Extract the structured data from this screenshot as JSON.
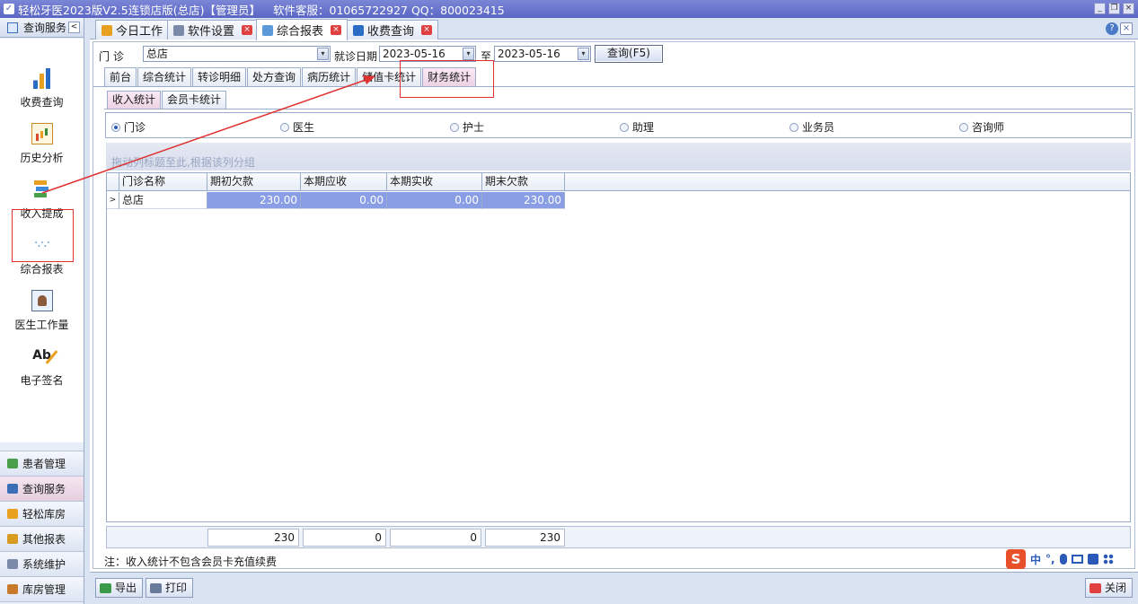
{
  "window": {
    "title": "轻松牙医2023版V2.5连锁店版(总店)【管理员】",
    "service": "软件客服：01065722927 QQ：800023415",
    "btn_min": "_",
    "btn_restore": "❐",
    "btn_close": "×"
  },
  "sidebar": {
    "header": "查询服务",
    "collapse": "<",
    "items": [
      {
        "label": "收费查询",
        "icon": "bar-chart-icon"
      },
      {
        "label": "历史分析",
        "icon": "history-chart-icon"
      },
      {
        "label": "收入提成",
        "icon": "stack-icon"
      },
      {
        "label": "综合报表",
        "icon": "dots-icon"
      },
      {
        "label": "医生工作量",
        "icon": "doctor-icon"
      },
      {
        "label": "电子签名",
        "icon": "signature-icon"
      }
    ],
    "nav": [
      {
        "label": "患者管理",
        "color": "#4aa04a"
      },
      {
        "label": "查询服务",
        "color": "#3a6fb8"
      },
      {
        "label": "轻松库房",
        "color": "#e8a020"
      },
      {
        "label": "其他报表",
        "color": "#d89a20"
      },
      {
        "label": "系统维护",
        "color": "#7a8aa8"
      },
      {
        "label": "库房管理",
        "color": "#c87a2a"
      }
    ],
    "expand": ">"
  },
  "doc_tabs": [
    {
      "label": "今日工作",
      "icon_color": "#e8a020"
    },
    {
      "label": "软件设置",
      "icon_color": "#7a8aa8"
    },
    {
      "label": "综合报表",
      "icon_color": "#5a9ad8"
    },
    {
      "label": "收费查询",
      "icon_color": "#2b6cc4"
    }
  ],
  "tab_close": "×",
  "help": "?",
  "help_close": "×",
  "filter": {
    "clinic_label": "门  诊",
    "clinic_value": "总店",
    "date_label": "就诊日期",
    "date_from": "2023-05-16",
    "to_label": "至",
    "date_to": "2023-05-16",
    "query_button": "查询(F5)",
    "arrow": "▾"
  },
  "report_tabs": [
    "前台",
    "综合统计",
    "转诊明细",
    "处方查询",
    "病历统计",
    "储值卡统计",
    "财务统计"
  ],
  "sub_tabs": [
    "收入统计",
    "会员卡统计"
  ],
  "radios": [
    {
      "label": "门诊",
      "checked": true
    },
    {
      "label": "医生",
      "checked": false
    },
    {
      "label": "护士",
      "checked": false
    },
    {
      "label": "助理",
      "checked": false
    },
    {
      "label": "业务员",
      "checked": false
    },
    {
      "label": "咨询师",
      "checked": false
    }
  ],
  "group_hint": "拖动列标题至此,根据该列分组",
  "grid": {
    "columns": [
      "门诊名称",
      "期初欠款",
      "本期应收",
      "本期实收",
      "期末欠款"
    ],
    "rows": [
      {
        "indicator": ">",
        "cells": [
          "总店",
          "230.00",
          "0.00",
          "0.00",
          "230.00"
        ]
      }
    ],
    "totals": [
      "230",
      "0",
      "0",
      "230"
    ]
  },
  "note": "注：收入统计不包含会员卡充值续费",
  "bottom": {
    "export": "导出",
    "print": "打印",
    "close": "关闭"
  },
  "ime": {
    "logo": "S",
    "lang": "中",
    "punct": "°,"
  }
}
